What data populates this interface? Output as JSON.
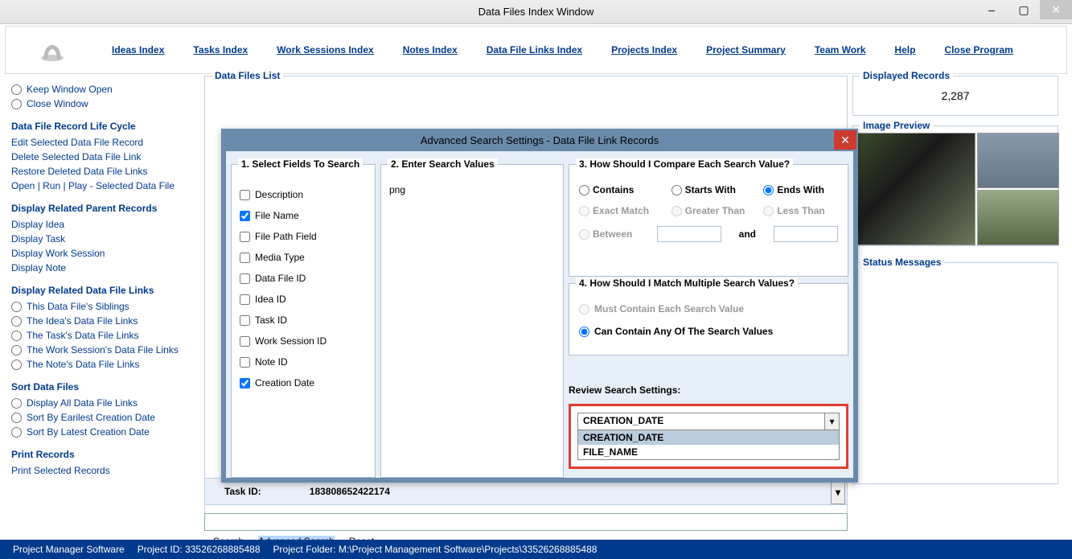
{
  "window": {
    "title": "Data Files Index Window",
    "minimize": "–",
    "maximize": "▢",
    "close": "✕"
  },
  "menu": {
    "items": [
      "Ideas Index",
      "Tasks Index",
      "Work Sessions Index",
      "Notes Index",
      "Data File Links Index",
      "Projects Index",
      "Project Summary",
      "Team Work",
      "Help",
      "Close Program"
    ]
  },
  "left": {
    "keep_open": "Keep Window Open",
    "close_window": "Close Window",
    "life_cycle_title": "Data File Record Life Cycle",
    "life_cycle": [
      "Edit Selected Data File Record",
      "Delete Selected Data File Link",
      "Restore Deleted Data File Links",
      "Open | Run | Play - Selected Data File"
    ],
    "parent_title": "Display Related Parent Records",
    "parent": [
      "Display Idea",
      "Display Task",
      "Display Work Session",
      "Display Note"
    ],
    "links_title": "Display Related Data File Links",
    "links": [
      "This Data File's Siblings",
      "The Idea's Data File Links",
      "The Task's Data File Links",
      "The Work Session's Data File Links",
      "The Note's Data File Links"
    ],
    "sort_title": "Sort Data Files",
    "sort": [
      "Display All Data File Links",
      "Sort By Earilest Creation Date",
      "Sort By Latest Creation Date"
    ],
    "print_title": "Print Records",
    "print": [
      "Print Selected Records"
    ]
  },
  "data_files_list": {
    "label": "Data Files List"
  },
  "displayed_records": {
    "label": "Displayed Records",
    "value": "2,287"
  },
  "image_preview": {
    "label": "Image Preview"
  },
  "status_messages": {
    "label": "Status Messages"
  },
  "task_bar": {
    "task_id_label": "Task ID:",
    "task_id_value": "183808652422174"
  },
  "search_links": {
    "search": "Search",
    "advanced": "Advanced Search",
    "reset": "Reset"
  },
  "statusbar": {
    "app": "Project Manager Software",
    "project_id": "Project ID:  33526268885488",
    "project_folder": "Project Folder: M:\\Project Management Software\\Projects\\33526268885488"
  },
  "dialog": {
    "title": "Advanced Search Settings - Data File Link Records",
    "close": "✕",
    "sect1": "1. Select Fields To Search",
    "fields": [
      "Description",
      "File Name",
      "File Path Field",
      "Media Type",
      "Data File ID",
      "Idea ID",
      "Task ID",
      "Work Session ID",
      "Note ID",
      "Creation Date"
    ],
    "fields_checked": [
      false,
      true,
      false,
      false,
      false,
      false,
      false,
      false,
      false,
      true
    ],
    "sect2": "2. Enter Search Values",
    "search_value": "png",
    "sect3": "3. How Should I Compare Each Search Value?",
    "compare": {
      "contains": "Contains",
      "starts_with": "Starts With",
      "ends_with": "Ends With",
      "exact": "Exact Match",
      "greater": "Greater Than",
      "less": "Less Than",
      "between": "Between",
      "and": "and",
      "selected": "ends_with"
    },
    "sect4": "4. How Should I Match Multiple Search Values?",
    "match": {
      "each": "Must Contain Each Search Value",
      "any": "Can Contain Any Of The Search Values",
      "selected": "any"
    },
    "review_label": "Review Search Settings:",
    "review_selected": "CREATION_DATE",
    "review_options": [
      "CREATION_DATE",
      "FILE_NAME"
    ]
  }
}
